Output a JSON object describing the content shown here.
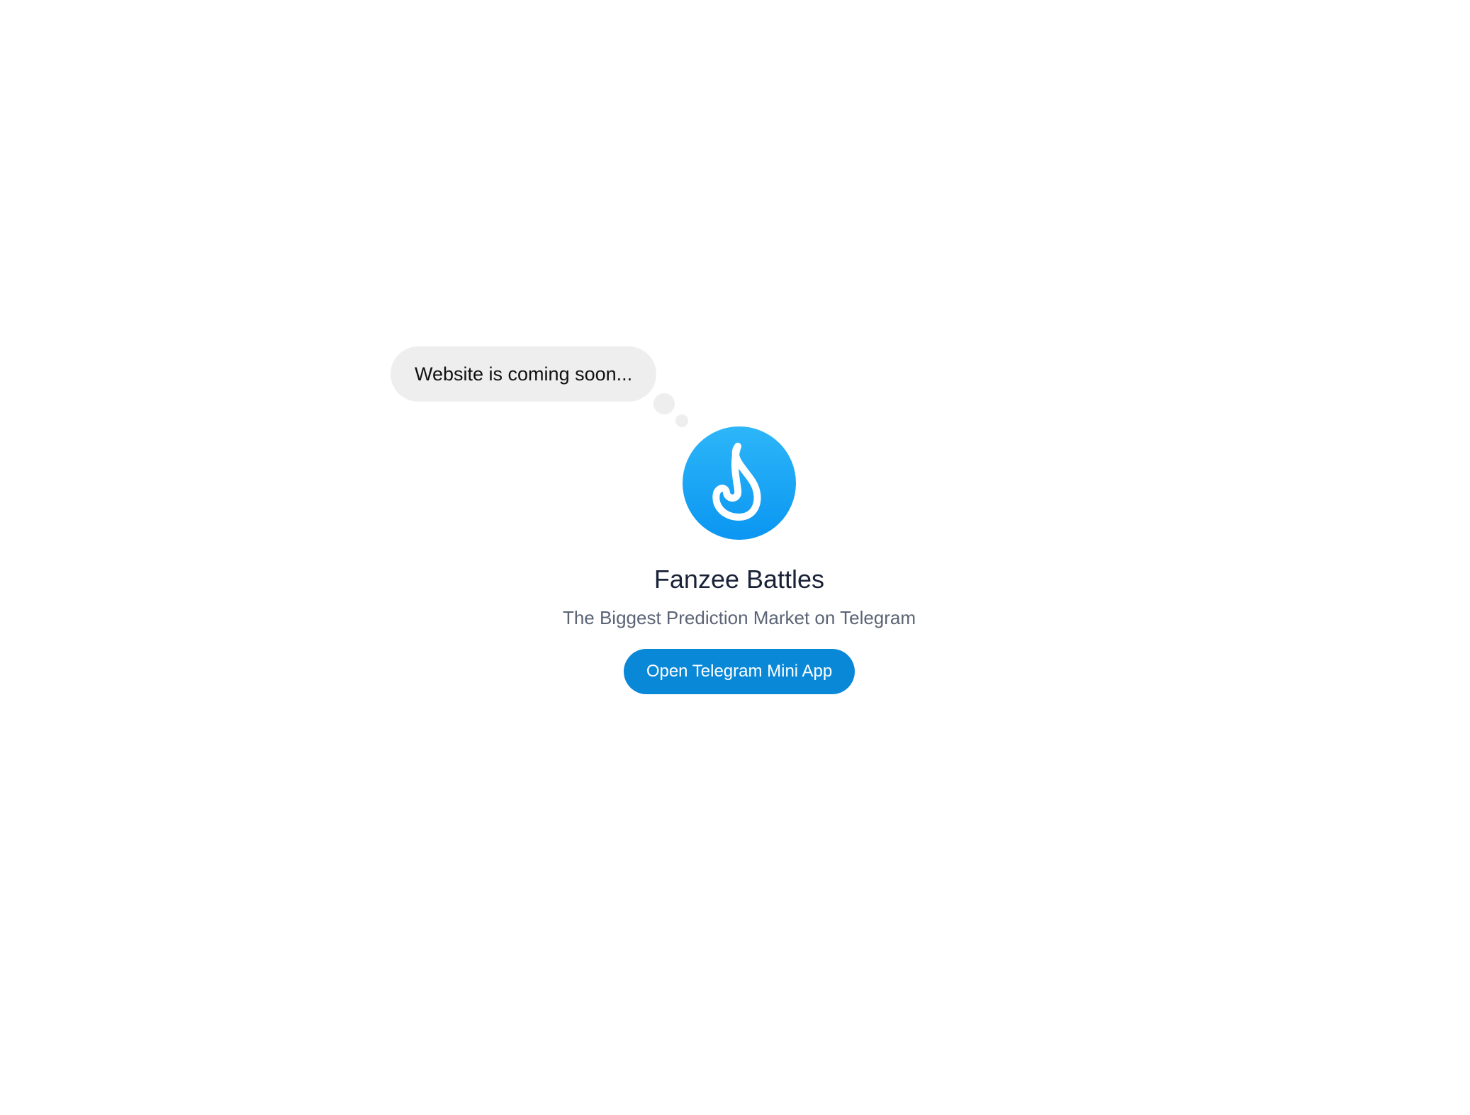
{
  "thought_bubble": {
    "text": "Website is coming soon..."
  },
  "brand": {
    "logo_icon": "flame-icon",
    "logo_color": "#0a96f2",
    "title": "Fanzee Battles",
    "tagline": "The Biggest Prediction Market on Telegram"
  },
  "cta": {
    "label": "Open Telegram Mini App",
    "color": "#0a88d8"
  }
}
